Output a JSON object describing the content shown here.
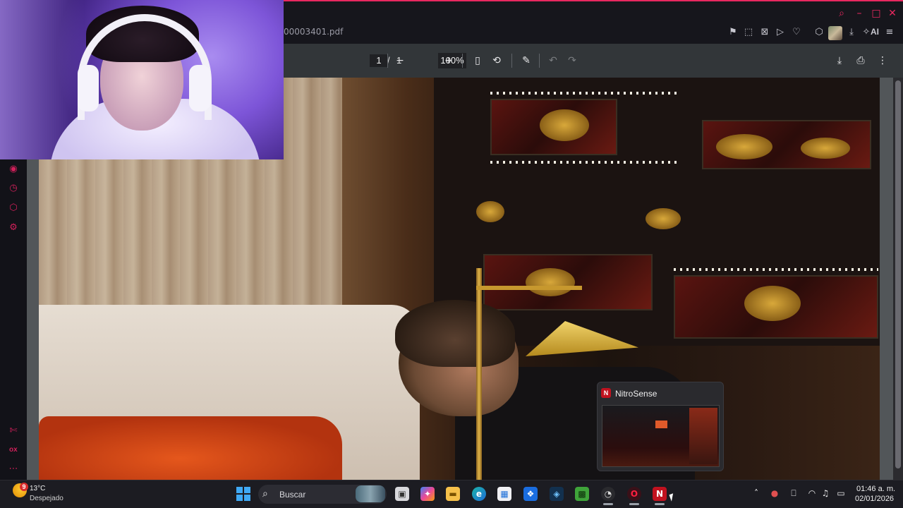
{
  "browser": {
    "tab_url": "00003401.pdf",
    "ai_label": "AI",
    "toolbar_icons": [
      "pin-icon",
      "screenshot-icon",
      "close-square-icon",
      "play-icon",
      "heart-icon",
      "extensions-icon",
      "profile-avatar",
      "download-icon",
      "ai-icon",
      "menu-icon"
    ],
    "window_controls": [
      "search-icon",
      "minimize-icon",
      "maximize-icon",
      "close-icon"
    ],
    "accent_color": "#e8285f"
  },
  "sidebar": {
    "items": [
      "player-icon",
      "history-icon",
      "extensions-icon",
      "settings-icon"
    ],
    "bottom": [
      "pin-icon",
      "ox-icon",
      "more-icon"
    ],
    "ox_label": "ox"
  },
  "pdf_viewer": {
    "page_current": "1",
    "page_separator": "/",
    "page_total": "1",
    "zoom": "100%",
    "bg_color": "#323639"
  },
  "webcam": {
    "bg_color": "#7d55d8"
  },
  "nitro_preview": {
    "title": "NitroSense",
    "icon_text": "N"
  },
  "taskbar": {
    "weather": {
      "badge": "9",
      "temp": "13°C",
      "desc": "Despejado"
    },
    "search_placeholder": "Buscar",
    "apps": [
      "start-icon",
      "search-icon",
      "task-view-icon",
      "copilot-icon",
      "file-explorer-icon",
      "edge-icon",
      "store-icon",
      "dropbox-icon",
      "app-icon",
      "minecraft-icon",
      "chrome-icon",
      "opera-gx-icon",
      "nitrosense-icon"
    ],
    "tray": [
      "chevron-up-icon",
      "security-icon",
      "microphone-icon",
      "wifi-icon",
      "volume-icon",
      "battery-icon"
    ],
    "clock_time": "01:46 a. m.",
    "clock_date": "02/01/2026"
  }
}
